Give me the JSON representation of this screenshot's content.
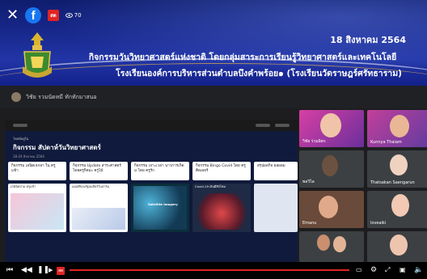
{
  "fb_bar": {
    "live_label": "สด",
    "viewers": "70"
  },
  "banner": {
    "date": "18 สิงหาคม 2564",
    "line1": "กิจกรรมวันวิทยาศาสตร์แห่งชาติ โดยกลุ่มสาระการเรียนรู้วิทยาศาสตร์และเทคโนโลยี",
    "line2": "โรงเรียนองค์การบริหารส่วนตำบลบึงคำพร้อย๑ (โรงเรียนวัดราษฎร์ศรัทธาราม)"
  },
  "meeting": {
    "title": "วิชัย รวมนัดหมี ทักทักมาสนอ"
  },
  "board": {
    "header_small": "โพสต์อยู่ใน",
    "title": "กิจกรรม สัปดาห์วันวิทยาศาสตร์",
    "subtitle": "18-24 สิงหาคม 2564",
    "columns": [
      {
        "head": "กิจกรรม เลนิดเจกลา ใน ครู แข้า",
        "card": "เลนินิหลาม ครูแข้า"
      },
      {
        "head": "กิจกรรม Update สาระศาสตร์ โดยครูกิตมะ ครูไม้",
        "card": "แผนที่ของรัฐเอเดียร์ในฟาร์ม"
      },
      {
        "head": "กิจกรรม เจาะเวลา นาวการเกิดม โดย ครูรัก",
        "card": "Satellite Imagery"
      },
      {
        "head": "กิจกรรม Bingo Covid โดย ครูศิลเลอร์",
        "card": "Covid-19 เงินมีอีกไหม"
      },
      {
        "head": "สรุปผลกิจ ผลผลม",
        "card": ""
      }
    ]
  },
  "participants": [
    {
      "name": "วิชัย ร่วมมิตร"
    },
    {
      "name": "Kunnya Thaiam"
    },
    {
      "name": "พลวิไล"
    },
    {
      "name": "Thatsakan Saengarun"
    },
    {
      "name": "Emanu"
    },
    {
      "name": "loveaiki"
    },
    {
      "name": ""
    },
    {
      "name": ""
    }
  ],
  "colors": {
    "banner": "#17278a",
    "live_red": "#e02424",
    "facebook_blue": "#1877f2",
    "meet_bg": "#1d1d1f"
  }
}
